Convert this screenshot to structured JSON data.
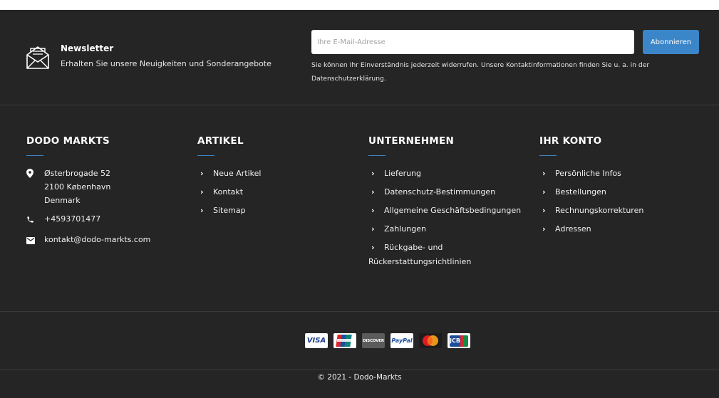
{
  "newsletter": {
    "title": "Newsletter",
    "subtitle": "Erhalten Sie unsere Neuigkeiten und Sonderangebote",
    "email_placeholder": "Ihre E-Mail-Adresse",
    "subscribe_label": "Abonnieren",
    "consent_text": "Sie können Ihr Einverständnis jederzeit widerrufen. Unsere Kontaktinformationen finden Sie u. a. in der Datenschutzerklärung."
  },
  "store": {
    "title": "DODO MARKTS",
    "address_line1": "Østerbrogade 52",
    "address_line2": "2100 København",
    "address_line3": "Denmark",
    "phone": "+4593701477",
    "email": "kontakt@dodo-markts.com"
  },
  "articles": {
    "title": "ARTIKEL",
    "items": [
      {
        "label": "Neue Artikel"
      },
      {
        "label": "Kontakt"
      },
      {
        "label": "Sitemap"
      }
    ]
  },
  "company": {
    "title": "UNTERNEHMEN",
    "items": [
      {
        "label": "Lieferung"
      },
      {
        "label": "Datenschutz-Bestimmungen"
      },
      {
        "label": "Allgemeine Geschäftsbedingungen"
      },
      {
        "label": "Zahlungen"
      },
      {
        "label": "Rückgabe- und Rückerstattungsrichtlinien"
      }
    ]
  },
  "account": {
    "title": "IHR KONTO",
    "items": [
      {
        "label": "Persönliche Infos"
      },
      {
        "label": "Bestellungen"
      },
      {
        "label": "Rechnungskorrekturen"
      },
      {
        "label": "Adressen"
      }
    ]
  },
  "payments": {
    "visa": "VISA",
    "discover": "DISCOVER",
    "paypal": "PayPal",
    "jcb": "JCB"
  },
  "copyright": "© 2021 - Dodo-Markts",
  "colors": {
    "background": "#252525",
    "accent": "#3a86c8",
    "divider": "#3a3a3a"
  }
}
